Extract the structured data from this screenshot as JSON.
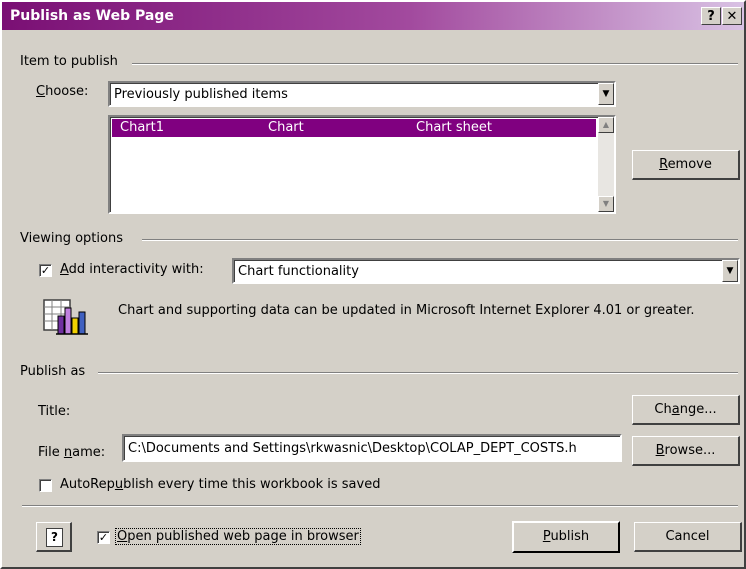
{
  "window": {
    "title": "Publish as Web Page",
    "help_btn": "?",
    "close_btn": "✕"
  },
  "item_group": {
    "title": "Item to publish",
    "choose_label_u": "C",
    "choose_label_rest": "hoose:",
    "choose_value": "Previously published items",
    "list": {
      "rows": [
        {
          "name": "Chart1",
          "type": "Chart",
          "location": "Chart sheet"
        }
      ]
    },
    "remove_btn_u": "R",
    "remove_btn_rest": "emove"
  },
  "viewing_group": {
    "title": "Viewing options",
    "interactivity_checked": true,
    "interactivity_label_u": "A",
    "interactivity_label_rest": "dd interactivity with:",
    "interactivity_value": "Chart functionality",
    "info_text": "Chart and supporting data can be updated in Microsoft Internet Explorer 4.01 or greater.",
    "info_icon": "chart-icon"
  },
  "publish_group": {
    "title": "Publish as",
    "title_label": "Title:",
    "change_btn_pre": "Ch",
    "change_btn_u": "a",
    "change_btn_rest": "nge...",
    "filename_label_pre": "File ",
    "filename_label_u": "n",
    "filename_label_rest": "ame:",
    "filename_value": "C:\\Documents and Settings\\rkwasnic\\Desktop\\COLAP_DEPT_COSTS.h",
    "browse_btn_u": "B",
    "browse_btn_rest": "rowse...",
    "autorepublish_checked": false,
    "autorepublish_pre": "AutoRep",
    "autorepublish_u": "u",
    "autorepublish_rest": "blish every time this workbook is saved"
  },
  "footer": {
    "help_icon": "question-icon",
    "open_checked": true,
    "open_label_u": "O",
    "open_label_rest": "pen published web page in browser",
    "publish_btn_u": "P",
    "publish_btn_rest": "ublish",
    "cancel_btn": "Cancel"
  }
}
